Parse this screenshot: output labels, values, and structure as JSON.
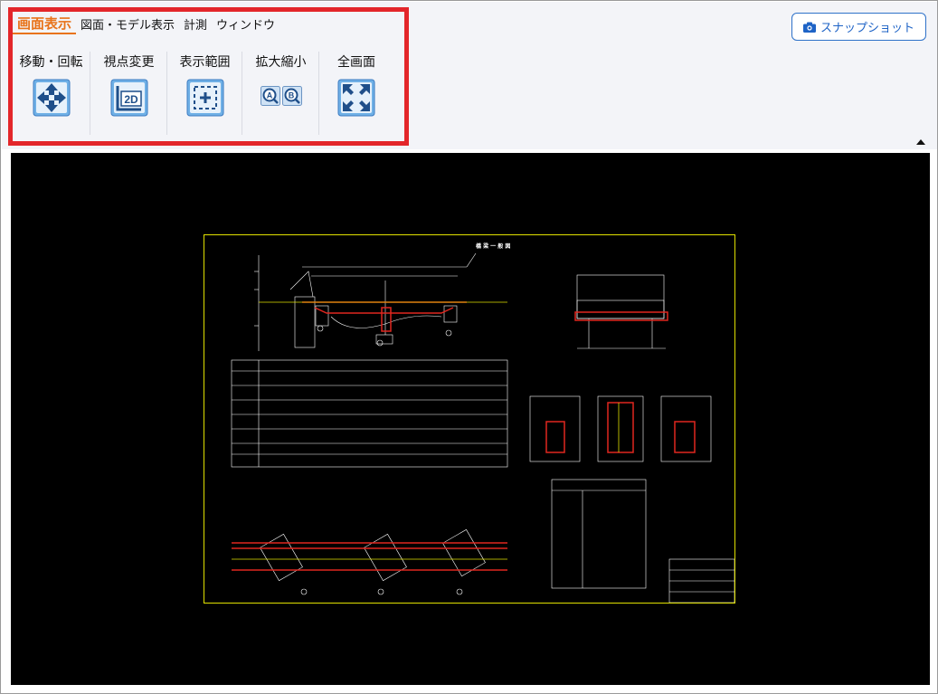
{
  "menu": {
    "tabs": [
      {
        "label": "画面表示",
        "active": true
      },
      {
        "label": "図面・モデル表示",
        "active": false
      },
      {
        "label": "計測",
        "active": false
      },
      {
        "label": "ウィンドウ",
        "active": false
      }
    ]
  },
  "tools": [
    {
      "label": "移動・回転",
      "icon": "move-arrows-icon"
    },
    {
      "label": "視点変更",
      "icon": "view-2d-icon"
    },
    {
      "label": "表示範囲",
      "icon": "display-range-icon"
    },
    {
      "label": "拡大縮小",
      "icon": "zoom-ab-icon"
    },
    {
      "label": "全画面",
      "icon": "fullscreen-icon"
    }
  ],
  "snapshot": {
    "label": "スナップショット",
    "icon": "camera-icon"
  },
  "drawing": {
    "sheet_title": "橋 梁 一 般 図"
  },
  "colors": {
    "accent_orange": "#e8731a",
    "highlight_red": "#e3262a",
    "icon_blue": "#1f5fa8",
    "snapshot_blue": "#1e63c6",
    "viewport_bg": "#000000",
    "sheet_border": "#e0e000"
  }
}
